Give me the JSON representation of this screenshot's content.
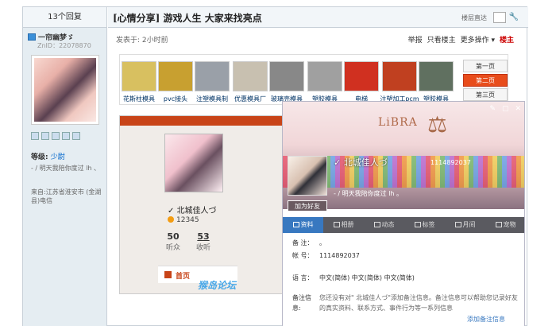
{
  "sidebar": {
    "reply_count": "13个回复",
    "author_name": "一帘幽梦ゞ",
    "zid": "ZnID：22078870",
    "level_label": "等级:",
    "level_value": "少尉",
    "signature": "- / 明天我陪你度过 lh 、",
    "location": "来自:江苏省淮安市 (金湖县)电信"
  },
  "post": {
    "title": "[心情分享] 游戏人生 大家来找亮点",
    "jump_label": "楼层直达",
    "meta": "发表于: 2小时前",
    "ops": {
      "report": "举报",
      "only_owner": "只看楼主",
      "more": "更多操作 ▾",
      "owner": "楼主"
    }
  },
  "gallery": {
    "items": [
      {
        "label": "花斯柱模具",
        "color": "#d8c060"
      },
      {
        "label": "pvc接头",
        "color": "#c8a030"
      },
      {
        "label": "注塑模具制",
        "color": "#9aa0a8"
      },
      {
        "label": "优惠模具厂",
        "color": "#c8c0b0"
      },
      {
        "label": "玻璃壳模具",
        "color": "#888888"
      },
      {
        "label": "塑胶模具",
        "color": "#a0a0a0"
      },
      {
        "label": "电梯",
        "color": "#d03020"
      },
      {
        "label": "注塑加工pcm",
        "color": "#c04020"
      },
      {
        "label": "塑胶模具",
        "color": "#607060"
      }
    ],
    "pager": [
      "第一页",
      "第二页",
      "第三页"
    ]
  },
  "embed": {
    "name": "北城佳人づ",
    "qq": "12345",
    "stats": [
      {
        "num": "50",
        "label": "听众"
      },
      {
        "num": "53",
        "label": "收听"
      }
    ],
    "home_tab": "首页",
    "watermark": "猴岛论坛"
  },
  "card": {
    "libra": "LiBRA",
    "name": "北城佳人づ",
    "qq_id": "1114892037",
    "signature": "- / 明天我陪你度过 lh 。",
    "add_friend": "加为好友",
    "tabs": [
      "资料",
      "相册",
      "动态",
      "标签",
      "月间",
      "宠物"
    ],
    "fields": {
      "remark_k": "备 注：",
      "remark_v": "。",
      "account_k": "帐 号：",
      "account_v": "1114892037",
      "language_k": "语 言：",
      "language_v": "中文(简体) 中文(简体) 中文(简体)",
      "note_k": "备注信息:",
      "note_v": "您还没有对\" 北城佳人づ\"添加备注信息。备注信息可以帮助您记录好友的真实资料、联系方式、事件行为等一系列信息",
      "add_note": "添加备注信息"
    }
  }
}
